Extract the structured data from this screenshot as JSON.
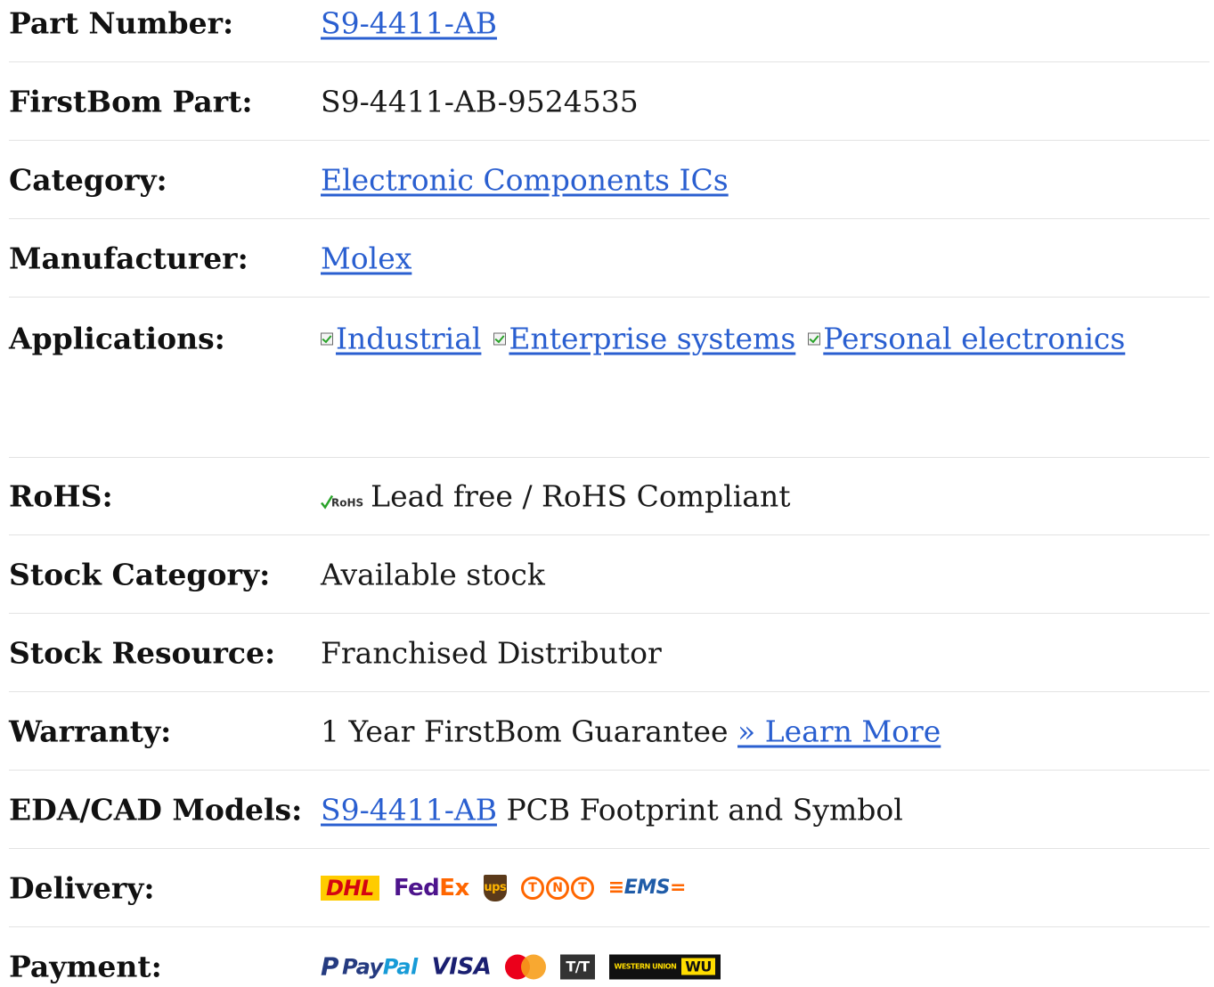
{
  "rows": {
    "part_number": {
      "label": "Part Number:",
      "value": "S9-4411-AB"
    },
    "firstbom_part": {
      "label": "FirstBom Part:",
      "value": "S9-4411-AB-9524535"
    },
    "category": {
      "label": "Category:",
      "value": "Electronic Components ICs"
    },
    "manufacturer": {
      "label": "Manufacturer:",
      "value": "Molex"
    },
    "applications": {
      "label": "Applications:",
      "items": [
        "Industrial",
        "Enterprise systems",
        "Personal electronics"
      ]
    },
    "rohs": {
      "label": "RoHS:",
      "logo_text": "RoHS",
      "value": "Lead free / RoHS Compliant"
    },
    "stock_category": {
      "label": "Stock Category:",
      "value": "Available stock"
    },
    "stock_resource": {
      "label": "Stock Resource:",
      "value": "Franchised Distributor"
    },
    "warranty": {
      "label": "Warranty:",
      "value": "1 Year FirstBom Guarantee",
      "link": "» Learn More"
    },
    "eda_cad": {
      "label": "EDA/CAD Models:",
      "link": "S9-4411-AB",
      "value": "PCB Footprint and Symbol"
    },
    "delivery": {
      "label": "Delivery:",
      "logos": {
        "dhl": "DHL",
        "fedex_fe": "Fed",
        "fedex_ex": "Ex",
        "ups": "ups",
        "tnt": [
          "T",
          "N",
          "T"
        ],
        "ems": "EMS"
      }
    },
    "payment": {
      "label": "Payment:",
      "logos": {
        "paypal_p1": "Pay",
        "paypal_p2": "Pal",
        "visa": "VISA",
        "tt": "T/T",
        "wu_text": "WESTERN UNION",
        "wu_badge": "WU"
      }
    }
  },
  "colors": {
    "link": "#2a5fd0",
    "divider": "#e3e3e3",
    "label": "#111111"
  }
}
